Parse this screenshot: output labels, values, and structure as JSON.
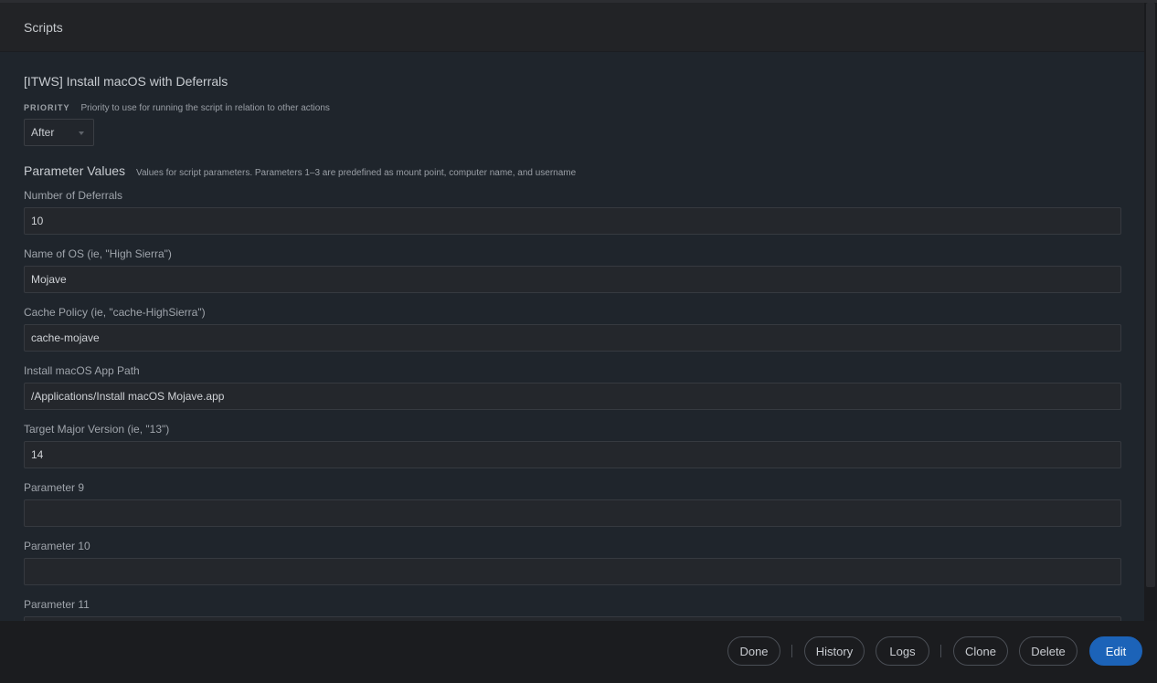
{
  "panel": {
    "title": "Scripts"
  },
  "script": {
    "name": "[ITWS] Install macOS with Deferrals",
    "priority": {
      "label": "PRIORITY",
      "description": "Priority to use for running the script in relation to other actions",
      "selected": "After"
    }
  },
  "parameters": {
    "title": "Parameter Values",
    "description": "Values for script parameters. Parameters 1–3 are predefined as mount point, computer name, and username",
    "fields": [
      {
        "label": "Number of Deferrals",
        "value": "10"
      },
      {
        "label": "Name of OS (ie, \"High Sierra\")",
        "value": "Mojave"
      },
      {
        "label": "Cache Policy (ie, \"cache-HighSierra\")",
        "value": "cache-mojave"
      },
      {
        "label": "Install macOS App Path",
        "value": "/Applications/Install macOS Mojave.app"
      },
      {
        "label": "Target Major Version (ie, \"13\")",
        "value": "14"
      },
      {
        "label": "Parameter 9",
        "value": ""
      },
      {
        "label": "Parameter 10",
        "value": ""
      },
      {
        "label": "Parameter 11",
        "value": ""
      }
    ]
  },
  "footer": {
    "done": "Done",
    "history": "History",
    "logs": "Logs",
    "clone": "Clone",
    "delete": "Delete",
    "edit": "Edit",
    "edit_color": "#1c63b8"
  }
}
